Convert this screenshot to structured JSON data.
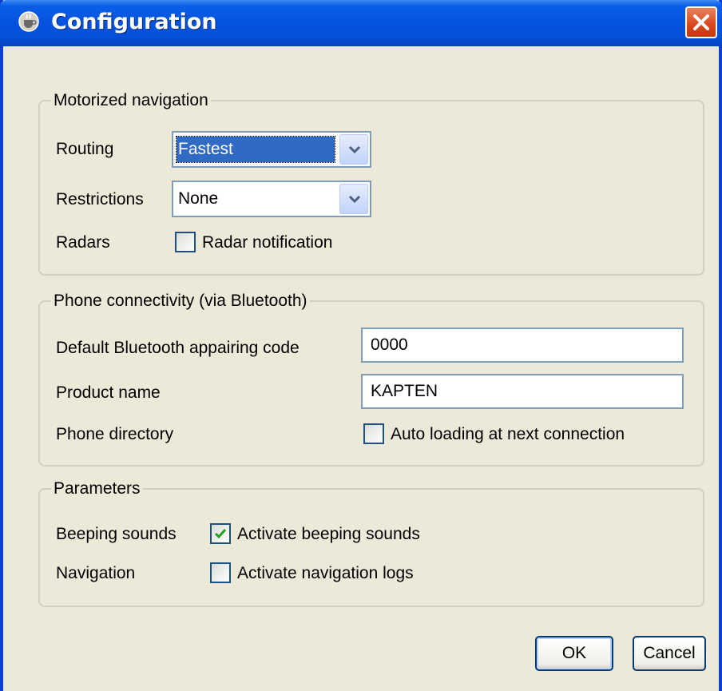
{
  "window": {
    "title": "Configuration",
    "icon": "java-cup-icon",
    "close_icon": "close-icon",
    "accent": "#0554e1",
    "close_color": "#d8461c"
  },
  "motorized": {
    "legend": "Motorized navigation",
    "routing_label": "Routing",
    "routing_value": "Fastest",
    "restrictions_label": "Restrictions",
    "restrictions_value": "None",
    "radars_label": "Radars",
    "radar_checkbox_label": "Radar notification",
    "radar_checked": false
  },
  "phone": {
    "legend": "Phone connectivity (via Bluetooth)",
    "pairing_label": "Default Bluetooth appairing code",
    "pairing_value": "0000",
    "product_label": "Product name",
    "product_value": "KAPTEN",
    "directory_label": "Phone directory",
    "autoload_label": "Auto loading at next connection",
    "autoload_checked": false
  },
  "parameters": {
    "legend": "Parameters",
    "beeping_label": "Beeping sounds",
    "beeping_checkbox_label": "Activate beeping sounds",
    "beeping_checked": true,
    "navigation_label": "Navigation",
    "navigation_checkbox_label": "Activate navigation logs",
    "navigation_checked": false
  },
  "buttons": {
    "ok": "OK",
    "cancel": "Cancel"
  }
}
